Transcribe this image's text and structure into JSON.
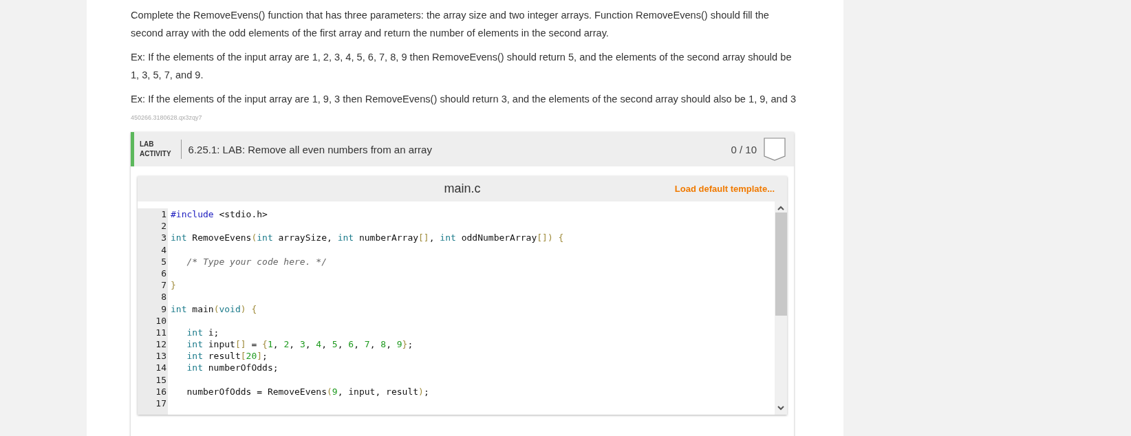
{
  "instructions": [
    {
      "text": "Complete the RemoveEvens() function that has three parameters: the array size and two integer arrays. Function RemoveEvens() should fill the second array with the odd elements of the first array and return the number of elements in the second array."
    },
    {
      "text": "Ex: If the elements of the input array are 1, 2, 3, 4, 5, 6, 7, 8, 9 then RemoveEvens() should return 5, and the elements of the second array should be 1, 3, 5, 7, and 9."
    },
    {
      "text": "Ex: If the elements of the input array are 1, 9, 3 then RemoveEvens() should return 3, and the elements of the second array should also be 1, 9, and 3"
    }
  ],
  "item_id": "450266.3180628.qx3zqy7",
  "lab": {
    "tag_line_1": "LAB",
    "tag_line_2": "ACTIVITY",
    "title": "6.25.1: LAB: Remove all even numbers from an array",
    "score": "0 / 10"
  },
  "editor": {
    "file_name": "main.c",
    "template_link": "Load default template...",
    "lines": [
      {
        "number": "1",
        "tokens": [
          {
            "kind": "meta",
            "text": "#include"
          },
          {
            "kind": "plain",
            "text": " <stdio.h>"
          }
        ]
      },
      {
        "number": "2"
      },
      {
        "number": "3",
        "tokens": [
          {
            "kind": "kw",
            "text": "int"
          },
          {
            "kind": "plain",
            "text": " RemoveEvens"
          },
          {
            "kind": "punc",
            "text": "("
          },
          {
            "kind": "kw",
            "text": "int"
          },
          {
            "kind": "plain",
            "text": " arraySize, "
          },
          {
            "kind": "kw",
            "text": "int"
          },
          {
            "kind": "plain",
            "text": " numberArray"
          },
          {
            "kind": "punc",
            "text": "[]"
          },
          {
            "kind": "plain",
            "text": ", "
          },
          {
            "kind": "kw",
            "text": "int"
          },
          {
            "kind": "plain",
            "text": " oddNumberArray"
          },
          {
            "kind": "punc",
            "text": "[]) {"
          }
        ]
      },
      {
        "number": "4"
      },
      {
        "number": "5",
        "tokens": [
          {
            "kind": "comment",
            "text": "   /* Type your code here. */"
          }
        ]
      },
      {
        "number": "6"
      },
      {
        "number": "7",
        "tokens": [
          {
            "kind": "punc",
            "text": "}"
          }
        ]
      },
      {
        "number": "8"
      },
      {
        "number": "9",
        "tokens": [
          {
            "kind": "kw",
            "text": "int"
          },
          {
            "kind": "plain",
            "text": " main"
          },
          {
            "kind": "punc",
            "text": "("
          },
          {
            "kind": "kw",
            "text": "void"
          },
          {
            "kind": "punc",
            "text": ") {"
          }
        ]
      },
      {
        "number": "10"
      },
      {
        "number": "11",
        "tokens": [
          {
            "kind": "kw",
            "text": "   int"
          },
          {
            "kind": "plain",
            "text": " i;"
          }
        ]
      },
      {
        "number": "12",
        "tokens": [
          {
            "kind": "kw",
            "text": "   int"
          },
          {
            "kind": "plain",
            "text": " input"
          },
          {
            "kind": "punc",
            "text": "[]"
          },
          {
            "kind": "plain",
            "text": " = "
          },
          {
            "kind": "punc",
            "text": "{"
          },
          {
            "kind": "num",
            "text": "1"
          },
          {
            "kind": "plain",
            "text": ", "
          },
          {
            "kind": "num",
            "text": "2"
          },
          {
            "kind": "plain",
            "text": ", "
          },
          {
            "kind": "num",
            "text": "3"
          },
          {
            "kind": "plain",
            "text": ", "
          },
          {
            "kind": "num",
            "text": "4"
          },
          {
            "kind": "plain",
            "text": ", "
          },
          {
            "kind": "num",
            "text": "5"
          },
          {
            "kind": "plain",
            "text": ", "
          },
          {
            "kind": "num",
            "text": "6"
          },
          {
            "kind": "plain",
            "text": ", "
          },
          {
            "kind": "num",
            "text": "7"
          },
          {
            "kind": "plain",
            "text": ", "
          },
          {
            "kind": "num",
            "text": "8"
          },
          {
            "kind": "plain",
            "text": ", "
          },
          {
            "kind": "num",
            "text": "9"
          },
          {
            "kind": "punc",
            "text": "}"
          },
          {
            "kind": "plain",
            "text": ";"
          }
        ]
      },
      {
        "number": "13",
        "tokens": [
          {
            "kind": "kw",
            "text": "   int"
          },
          {
            "kind": "plain",
            "text": " result"
          },
          {
            "kind": "punc",
            "text": "["
          },
          {
            "kind": "num",
            "text": "20"
          },
          {
            "kind": "punc",
            "text": "]"
          },
          {
            "kind": "plain",
            "text": ";"
          }
        ]
      },
      {
        "number": "14",
        "tokens": [
          {
            "kind": "kw",
            "text": "   int"
          },
          {
            "kind": "plain",
            "text": " numberOfOdds;"
          }
        ]
      },
      {
        "number": "15"
      },
      {
        "number": "16",
        "tokens": [
          {
            "kind": "plain",
            "text": "   numberOfOdds = RemoveEvens"
          },
          {
            "kind": "punc",
            "text": "("
          },
          {
            "kind": "num",
            "text": "9"
          },
          {
            "kind": "plain",
            "text": ", input, result"
          },
          {
            "kind": "punc",
            "text": ")"
          },
          {
            "kind": "plain",
            "text": ";"
          }
        ]
      },
      {
        "number": "17"
      }
    ]
  }
}
